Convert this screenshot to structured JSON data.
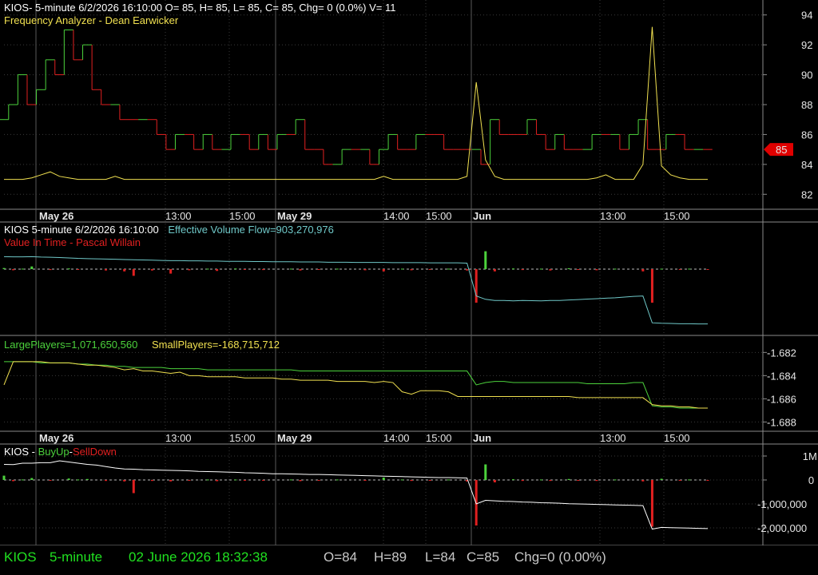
{
  "colors": {
    "red": "#e02020",
    "green": "#4cd23c",
    "yellow": "#f0e050",
    "cyan": "#6fc8c8",
    "white": "#ffffff",
    "grid": "#5a5a5a",
    "status_green": "#20e020",
    "status_gray": "#c8c8c8"
  },
  "panel1": {
    "header": "KIOS- 5-minute 6/2/2026 16:10:00 O= 85, H= 85, L= 85, C= 85, Chg= 0 (0.0%) V= 11",
    "indicator": "Frequency Analyzer - Dean Earwicker",
    "last_price_badge": "85"
  },
  "panel2": {
    "header": "KIOS 5-minute  6/2/2026 16:10:00",
    "flow_label": "Effective Volume Flow=903,270,976",
    "indicator": "Value In Time - Pascal Willain"
  },
  "panel3": {
    "large_label": "LargePlayers=1,071,650,560",
    "small_label": "SmallPlayers=-168,715,712"
  },
  "panel4": {
    "prefix": "KIOS - ",
    "buy_label": "BuyUp",
    "dash": "-",
    "sell_label": "SellDown"
  },
  "date_axis": [
    {
      "label": "May 26",
      "bold": true
    },
    {
      "label": "13:00",
      "bold": false
    },
    {
      "label": "15:00",
      "bold": false
    },
    {
      "label": "May 29",
      "bold": true
    },
    {
      "label": "14:00",
      "bold": false
    },
    {
      "label": "15:00",
      "bold": false
    },
    {
      "label": "Jun",
      "bold": true
    },
    {
      "label": "13:00",
      "bold": false
    },
    {
      "label": "15:00",
      "bold": false
    }
  ],
  "status_bar": {
    "symbol": "KIOS",
    "interval": "5-minute",
    "datetime": "02 June 2026 18:32:38",
    "open": "O=84",
    "high": "H=89",
    "low": "L=84",
    "close": "C=85",
    "change": "Chg=0 (0.00%)"
  },
  "chart_data": [
    {
      "type": "line",
      "title": "Frequency Analyzer - Dean Earwicker",
      "ylim": [
        81,
        95
      ],
      "yticks": [
        "82",
        "84",
        "86",
        "88",
        "90",
        "92",
        "94"
      ],
      "series": [
        {
          "name": "KIOS",
          "style": "step",
          "colored_by_direction": true,
          "values": [
            87,
            88,
            90,
            88,
            89,
            91,
            90,
            93,
            91,
            92,
            89,
            88,
            88,
            87,
            87,
            87,
            87,
            86,
            85,
            86,
            86,
            85,
            86,
            85,
            85,
            86,
            86,
            85,
            86,
            85,
            86,
            86,
            87,
            85,
            85,
            84,
            84,
            85,
            85,
            85,
            84,
            85,
            86,
            85,
            85,
            86,
            86,
            86,
            85,
            85,
            85,
            85,
            84,
            87,
            86,
            86,
            86,
            87,
            86,
            85,
            86,
            85,
            85,
            85,
            86,
            86,
            86,
            85,
            86,
            87,
            85,
            85,
            86,
            86,
            85,
            85,
            85
          ]
        },
        {
          "name": "Frequency Analyzer - Dean Earwicker",
          "color": "yellow",
          "values": [
            83,
            83,
            83,
            83.1,
            83.3,
            83.5,
            83.2,
            83.1,
            83,
            83,
            83,
            83,
            83.2,
            83,
            83,
            83,
            83,
            83,
            83,
            83,
            83,
            83,
            83,
            83,
            83,
            83,
            83,
            83,
            83,
            83,
            83,
            83,
            83,
            83,
            83,
            83,
            83,
            83,
            83,
            83,
            83,
            83.2,
            83,
            83,
            83,
            83,
            83,
            83,
            83,
            83,
            83.2,
            89.5,
            84.3,
            83.2,
            83,
            83,
            83,
            83,
            83,
            83,
            83,
            83,
            83,
            83,
            83.1,
            83.3,
            83,
            83,
            83,
            84,
            93.2,
            83.9,
            83.3,
            83.1,
            83,
            83,
            83
          ]
        }
      ],
      "last_value_badge": 85
    },
    {
      "type": "line",
      "title": "Value In Time - Pascal Willain",
      "series": [
        {
          "name": "Effective Volume Flow",
          "color": "cyan",
          "values": [
            0.56,
            0.55,
            0.55,
            0.56,
            0.54,
            0.53,
            0.52,
            0.5,
            0.48,
            0.47,
            0.46,
            0.45,
            0.44,
            0.43,
            0.42,
            0.41,
            0.4,
            0.39,
            0.38,
            0.38,
            0.37,
            0.37,
            0.36,
            0.36,
            0.35,
            0.35,
            0.35,
            0.34,
            0.34,
            0.33,
            0.33,
            0.33,
            0.32,
            0.32,
            0.32,
            0.31,
            0.31,
            0.31,
            0.3,
            0.3,
            0.3,
            0.3,
            0.29,
            0.29,
            0.29,
            0.29,
            0.28,
            0.28,
            0.28,
            0.28,
            0.27,
            -1.2,
            -1.35,
            -1.4,
            -1.4,
            -1.42,
            -1.4,
            -1.41,
            -1.42,
            -1.4,
            -1.4,
            -1.38,
            -1.36,
            -1.34,
            -1.32,
            -1.3,
            -1.28,
            -1.25,
            -1.22,
            -1.2,
            -2.4,
            -2.42,
            -2.43,
            -2.44,
            -2.44,
            -2.45,
            -2.45
          ]
        },
        {
          "name": "Volume",
          "style": "histogram",
          "colored_by_sign": true,
          "values": [
            0.05,
            -0.05,
            0.02,
            0.12,
            0,
            -0.04,
            0,
            0.03,
            -0.02,
            0,
            0,
            -0.06,
            0,
            -0.1,
            -0.3,
            0,
            -0.06,
            0,
            -0.2,
            0,
            -0.05,
            0,
            0.02,
            -0.08,
            0,
            0.03,
            -0.02,
            0,
            -0.04,
            0,
            0,
            0.02,
            -0.06,
            0,
            -0.03,
            0,
            0.02,
            0,
            0,
            -0.05,
            0,
            -0.1,
            0,
            0.02,
            -0.05,
            0,
            -0.03,
            0,
            0.02,
            0,
            -0.06,
            -1.5,
            0.8,
            -0.1,
            0,
            0.03,
            -0.04,
            0,
            0.02,
            -0.06,
            0,
            0.04,
            -0.03,
            0,
            -0.05,
            0,
            0.02,
            0,
            0,
            -0.1,
            -1.5,
            0.02,
            0,
            -0.02,
            0.02,
            0,
            -0.02
          ]
        }
      ]
    },
    {
      "type": "line",
      "ylim": [
        -1.6888,
        -1.6806
      ],
      "yticks": [
        "-1.682",
        "-1.684",
        "-1.686",
        "-1.688"
      ],
      "series": [
        {
          "name": "LargePlayers",
          "color": "green",
          "values": [
            -1.6828,
            -1.6828,
            -1.6828,
            -1.6828,
            -1.6829,
            -1.6829,
            -1.6829,
            -1.6829,
            -1.683,
            -1.683,
            -1.6831,
            -1.6831,
            -1.6832,
            -1.6832,
            -1.6833,
            -1.6833,
            -1.6833,
            -1.6833,
            -1.6834,
            -1.6834,
            -1.6834,
            -1.6834,
            -1.6835,
            -1.6835,
            -1.6835,
            -1.6835,
            -1.6835,
            -1.6835,
            -1.6835,
            -1.6835,
            -1.6835,
            -1.6835,
            -1.6836,
            -1.6836,
            -1.6836,
            -1.6836,
            -1.6836,
            -1.6836,
            -1.6836,
            -1.6836,
            -1.6836,
            -1.6836,
            -1.6836,
            -1.6836,
            -1.6836,
            -1.6836,
            -1.6836,
            -1.6836,
            -1.6836,
            -1.6836,
            -1.6836,
            -1.6848,
            -1.6846,
            -1.6845,
            -1.6845,
            -1.6846,
            -1.6846,
            -1.6846,
            -1.6846,
            -1.6846,
            -1.6846,
            -1.6846,
            -1.6846,
            -1.6847,
            -1.6847,
            -1.6847,
            -1.6847,
            -1.6847,
            -1.6846,
            -1.6846,
            -1.6866,
            -1.6867,
            -1.6867,
            -1.6868,
            -1.6868,
            -1.6868,
            -1.6868
          ]
        },
        {
          "name": "SmallPlayers",
          "color": "yellow",
          "values": [
            -1.6848,
            -1.6828,
            -1.6828,
            -1.6828,
            -1.6828,
            -1.6829,
            -1.6829,
            -1.6829,
            -1.683,
            -1.6831,
            -1.6831,
            -1.6832,
            -1.6833,
            -1.6835,
            -1.6834,
            -1.6836,
            -1.6836,
            -1.6837,
            -1.6838,
            -1.6837,
            -1.684,
            -1.684,
            -1.6841,
            -1.6841,
            -1.6841,
            -1.6841,
            -1.6842,
            -1.6842,
            -1.6842,
            -1.6842,
            -1.6843,
            -1.6843,
            -1.6844,
            -1.6844,
            -1.6844,
            -1.6844,
            -1.6845,
            -1.6845,
            -1.6845,
            -1.6845,
            -1.6846,
            -1.6845,
            -1.6846,
            -1.6854,
            -1.6856,
            -1.6853,
            -1.6853,
            -1.6853,
            -1.6854,
            -1.6858,
            -1.6858,
            -1.6858,
            -1.6858,
            -1.6858,
            -1.6858,
            -1.6858,
            -1.6858,
            -1.6858,
            -1.6858,
            -1.6858,
            -1.6858,
            -1.6858,
            -1.6859,
            -1.6859,
            -1.6859,
            -1.6859,
            -1.6859,
            -1.6859,
            -1.6859,
            -1.6859,
            -1.6865,
            -1.6866,
            -1.6866,
            -1.6867,
            -1.6867,
            -1.6868,
            -1.6868
          ]
        }
      ]
    },
    {
      "type": "line",
      "title": "KIOS - BuyUp-SellDown",
      "ylim": [
        -2300000,
        1300000
      ],
      "yticks": [
        "1M",
        "0",
        "-1,000,000",
        "-2,000,000"
      ],
      "ytick_values": [
        1000000,
        0,
        -1000000,
        -2000000
      ],
      "series": [
        {
          "name": "BuyUp-SellDown",
          "color": "white",
          "values": [
            650000,
            640000,
            700000,
            700000,
            720000,
            720000,
            800000,
            750000,
            700000,
            650000,
            620000,
            560000,
            500000,
            460000,
            450000,
            430000,
            420000,
            410000,
            400000,
            390000,
            380000,
            360000,
            350000,
            340000,
            330000,
            320000,
            300000,
            290000,
            280000,
            260000,
            260000,
            250000,
            240000,
            230000,
            230000,
            220000,
            210000,
            200000,
            190000,
            180000,
            170000,
            160000,
            150000,
            140000,
            130000,
            120000,
            110000,
            100000,
            100000,
            90000,
            80000,
            -1000000,
            -850000,
            -870000,
            -890000,
            -900000,
            -920000,
            -930000,
            -950000,
            -960000,
            -970000,
            -990000,
            -1000000,
            -1010000,
            -1020000,
            -1030000,
            -1040000,
            -1050000,
            -1060000,
            -1070000,
            -2050000,
            -1980000,
            -1990000,
            -2000000,
            -2010000,
            -2020000,
            -2030000
          ]
        },
        {
          "name": "Volume",
          "style": "histogram",
          "colored_by_sign": true,
          "values": [
            180000,
            -50000,
            20000,
            80000,
            0,
            -30000,
            0,
            60000,
            20000,
            40000,
            0,
            -40000,
            0,
            -60000,
            -550000,
            0,
            -40000,
            0,
            -60000,
            0,
            -30000,
            0,
            20000,
            -50000,
            0,
            20000,
            -20000,
            0,
            -20000,
            0,
            0,
            20000,
            -50000,
            0,
            -20000,
            0,
            20000,
            0,
            0,
            -30000,
            0,
            100000,
            0,
            20000,
            -40000,
            0,
            -20000,
            0,
            20000,
            0,
            -60000,
            -1900000,
            650000,
            -100000,
            0,
            30000,
            -40000,
            0,
            20000,
            -40000,
            0,
            40000,
            -30000,
            0,
            -40000,
            0,
            20000,
            0,
            0,
            -60000,
            -1950000,
            50000,
            0,
            -20000,
            20000,
            0,
            -20000
          ]
        }
      ]
    }
  ]
}
